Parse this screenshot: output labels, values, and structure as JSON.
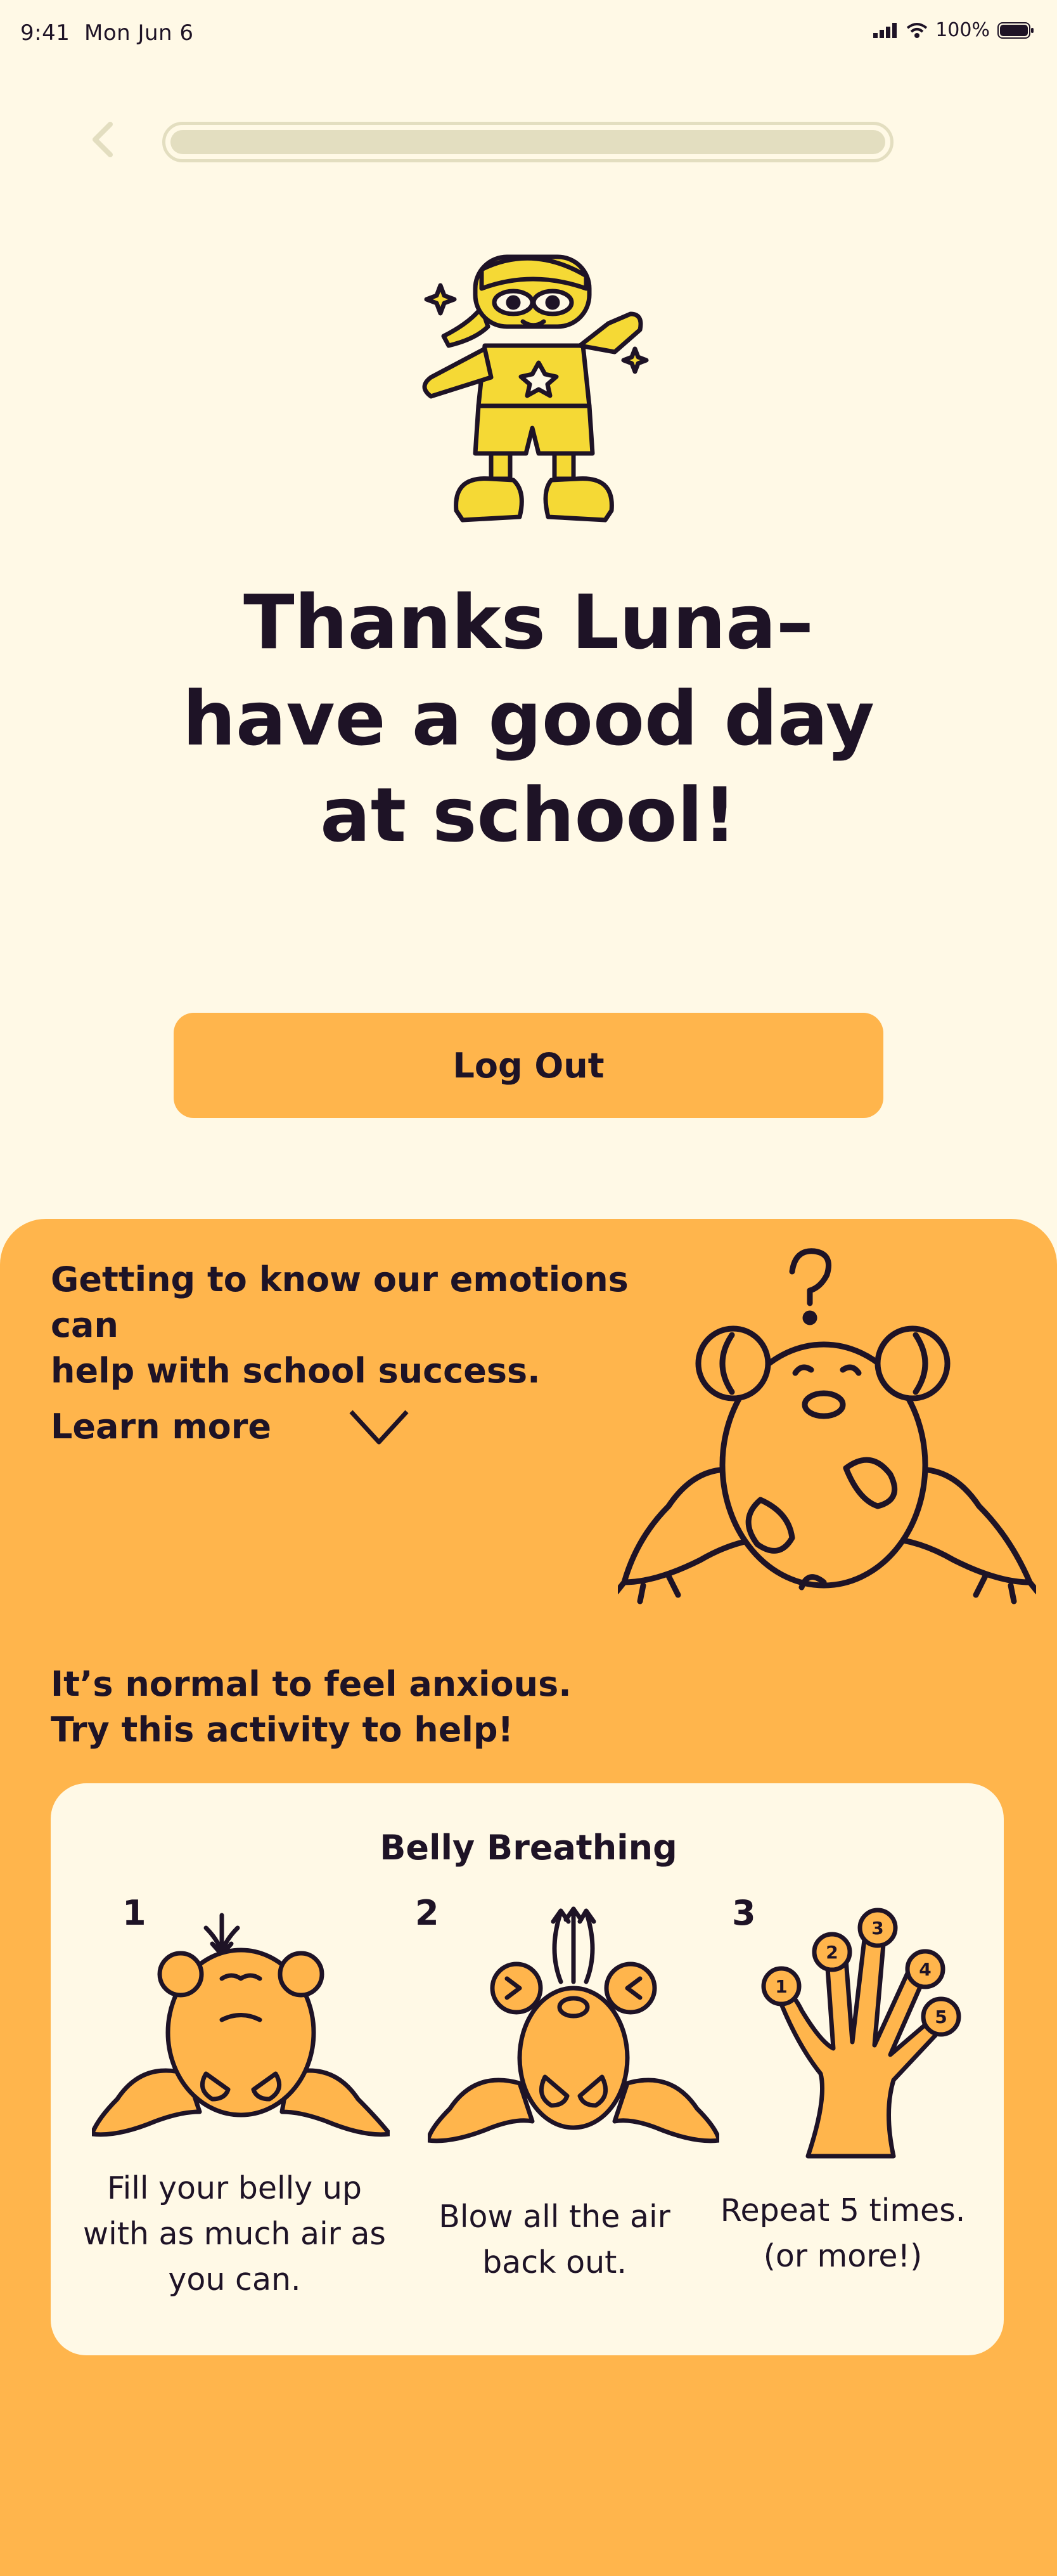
{
  "status_bar": {
    "time": "9:41",
    "date": "Mon Jun 6",
    "battery": "100%"
  },
  "progress": {
    "value": 1.0
  },
  "headline": {
    "line1": "Thanks Luna–",
    "line2": "have a good day",
    "line3": "at school!"
  },
  "logout_label": "Log Out",
  "info": {
    "line1": "Getting to know our emotions can",
    "line2": "help with school success.",
    "learn_more": "Learn more"
  },
  "anxious": {
    "line1": "It’s normal to feel anxious.",
    "line2": "Try this activity to help!"
  },
  "activity": {
    "title": "Belly Breathing",
    "steps": [
      {
        "number": "1",
        "line1": "Fill your belly up",
        "line2": "with as much air as",
        "line3": "you can."
      },
      {
        "number": "2",
        "line1": "Blow all the air",
        "line2": "back out."
      },
      {
        "number": "3",
        "line1": "Repeat 5 times.",
        "line2": "(or more!)"
      }
    ],
    "finger_labels": [
      "1",
      "2",
      "3",
      "4",
      "5"
    ]
  },
  "colors": {
    "background": "#fff9e6",
    "accent": "#ffb54c",
    "text": "#1e1326",
    "mascot_yellow": "#f5d935"
  }
}
